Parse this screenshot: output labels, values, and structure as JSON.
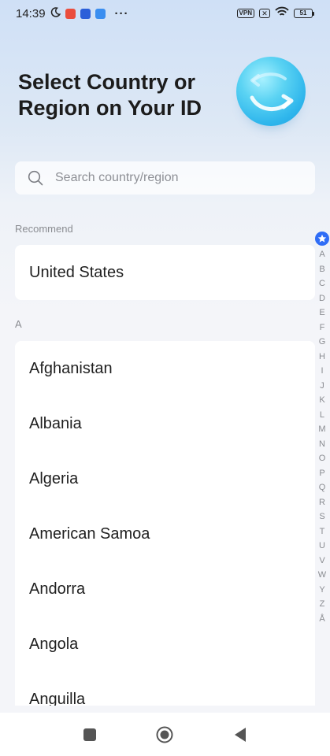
{
  "status_bar": {
    "time": "14:39",
    "dots": "···",
    "vpn": "VPN",
    "x_badge": "✕",
    "battery": "51",
    "icons": [
      "moon-icon",
      "app-icon-red",
      "app-icon-blue",
      "app-icon-store",
      "vpn-icon",
      "no-sim-icon",
      "wifi-icon",
      "battery-icon"
    ]
  },
  "header": {
    "title": "Select Country or Region on Your ID",
    "illustration": "globe-icon"
  },
  "search": {
    "placeholder": "Search country/region"
  },
  "recommend": {
    "label": "Recommend",
    "items": [
      "United States"
    ]
  },
  "section_a": {
    "label": "A",
    "items": [
      "Afghanistan",
      "Albania",
      "Algeria",
      "American Samoa",
      "Andorra",
      "Angola",
      "Anguilla"
    ]
  },
  "alpha_index": [
    "A",
    "B",
    "C",
    "D",
    "E",
    "F",
    "G",
    "H",
    "I",
    "J",
    "K",
    "L",
    "M",
    "N",
    "O",
    "P",
    "Q",
    "R",
    "S",
    "T",
    "U",
    "V",
    "W",
    "Y",
    "Z",
    "Å"
  ],
  "nav": {
    "buttons": [
      "recent-apps",
      "home",
      "back"
    ]
  },
  "colors": {
    "accent": "#2f6df6",
    "card": "#ffffff",
    "background": "#f4f5f9",
    "muted_text": "#8a8c91"
  }
}
